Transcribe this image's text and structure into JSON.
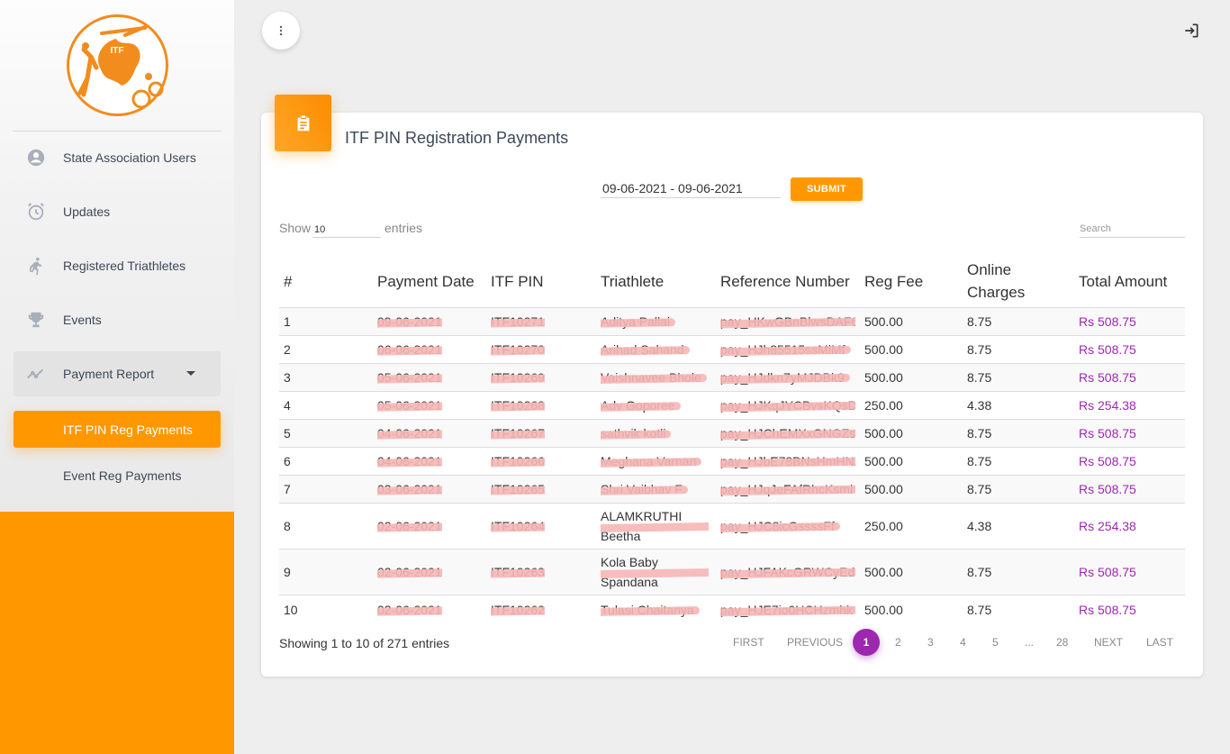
{
  "sidebar": {
    "logo": {
      "text": "ITF",
      "name": "itf-logo"
    },
    "nav": [
      {
        "label": "State Association Users",
        "icon": "account-circle-icon"
      },
      {
        "label": "Updates",
        "icon": "alarm-clock-icon"
      },
      {
        "label": "Registered Triathletes",
        "icon": "running-person-icon"
      },
      {
        "label": "Events",
        "icon": "trophy-icon"
      },
      {
        "label": "Payment Report",
        "icon": "trending-up-icon"
      }
    ],
    "sub": [
      {
        "label": "ITF PIN Reg Payments"
      },
      {
        "label": "Event Reg Payments"
      }
    ]
  },
  "header": {
    "menu_icon": "more-vert-icon",
    "logout_icon": "logout-icon"
  },
  "card": {
    "icon": "clipboard-icon",
    "title": "ITF PIN Registration Payments",
    "date_range": "09-06-2021 - 09-06-2021",
    "submit_label": "SUBMIT",
    "show_label": "Show",
    "show_value": "10",
    "entries_label": "entries",
    "search_placeholder": "Search"
  },
  "table": {
    "headers": [
      "#",
      "Payment Date",
      "ITF PIN",
      "Triathlete",
      "Reference Number",
      "Reg Fee",
      "Online Charges",
      "Total Amount"
    ],
    "rows": [
      {
        "n": "1",
        "date": "09-06-2021",
        "pin": "ITF10271",
        "name": "Aditya Pallai",
        "ref": "pay_HKwGBnBlwsDAF6",
        "fee": "500.00",
        "charges": "8.75",
        "total": "Rs 508.75"
      },
      {
        "n": "2",
        "date": "06-06-2021",
        "pin": "ITF10270",
        "name": "Arihad Sahand",
        "ref": "pay_HJh85515ssMlMf",
        "fee": "500.00",
        "charges": "8.75",
        "total": "Rs 508.75"
      },
      {
        "n": "3",
        "date": "05-06-2021",
        "pin": "ITF10269",
        "name": "Vaishnavee Bhole",
        "ref": "pay_HJdkn7yMJDBk9",
        "fee": "500.00",
        "charges": "8.75",
        "total": "Rs 508.75"
      },
      {
        "n": "4",
        "date": "05-06-2021",
        "pin": "ITF10268",
        "name": "Adv Goporee",
        "ref": "pay_HJKqJYCBvsKQsD",
        "fee": "250.00",
        "charges": "4.38",
        "total": "Rs 254.38"
      },
      {
        "n": "5",
        "date": "04-06-2021",
        "pin": "ITF10267",
        "name": "sathvik kotli",
        "ref": "pay_HJChEMXxGNGZsyl",
        "fee": "500.00",
        "charges": "8.75",
        "total": "Rs 508.75"
      },
      {
        "n": "6",
        "date": "04-06-2021",
        "pin": "ITF10266",
        "name": "Meghana Varnan",
        "ref": "pay_HJbE78BNsHmHNZ",
        "fee": "500.00",
        "charges": "8.75",
        "total": "Rs 508.75"
      },
      {
        "n": "7",
        "date": "03-06-2021",
        "pin": "ITF10265",
        "name": "Shri Vaibhav F",
        "ref": "pay_HJqJeFAfRhcKsml",
        "fee": "500.00",
        "charges": "8.75",
        "total": "Rs 508.75"
      },
      {
        "n": "8",
        "date": "02-06-2021",
        "pin": "ITF10264",
        "name": "ALAMKRUTHI Beetha",
        "ref": "pay_HJC8icGssssFf",
        "fee": "250.00",
        "charges": "4.38",
        "total": "Rs 254.38"
      },
      {
        "n": "9",
        "date": "02-06-2021",
        "pin": "ITF10263",
        "name": "Kola Baby Spandana",
        "ref": "pay_HJFAKcGRWCyEd",
        "fee": "500.00",
        "charges": "8.75",
        "total": "Rs 508.75"
      },
      {
        "n": "10",
        "date": "02-06-2021",
        "pin": "ITF10262",
        "name": "Tulasi Chaitanya",
        "ref": "pay_HJE7io0HCHzmhk",
        "fee": "500.00",
        "charges": "8.75",
        "total": "Rs 508.75"
      }
    ]
  },
  "footer": {
    "showing": "Showing 1 to 10 of 271 entries",
    "first": "FIRST",
    "previous": "PREVIOUS",
    "pages": [
      "1",
      "2",
      "3",
      "4",
      "5",
      "...",
      "28"
    ],
    "next": "NEXT",
    "last": "LAST"
  },
  "colors": {
    "accent": "#ff9800",
    "active_page": "#9c27b0",
    "amount": "#9c27b0"
  }
}
